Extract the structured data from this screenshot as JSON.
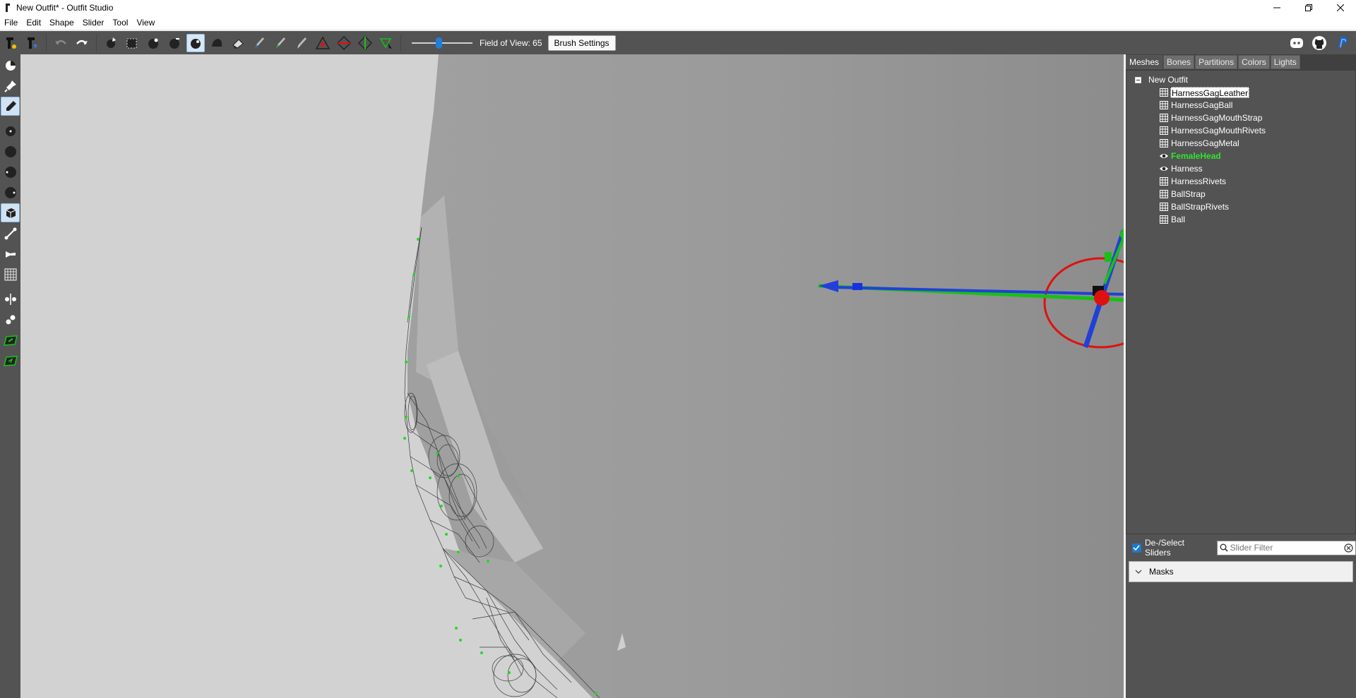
{
  "window": {
    "title": "New Outfit* - Outfit Studio"
  },
  "menu": [
    "File",
    "Edit",
    "Shape",
    "Slider",
    "Tool",
    "View"
  ],
  "toolbar": {
    "fov_label": "Field of View: 65",
    "fov_value": 65,
    "brush_settings_label": "Brush Settings",
    "tools": [
      "new-project-icon",
      "load-project-icon",
      "undo-icon",
      "redo-icon",
      "select-brush-icon",
      "mask-brush-icon",
      "inflate-brush-icon",
      "deflate-brush-icon",
      "move-brush-icon",
      "smooth-brush-icon",
      "undiff-brush-icon",
      "weight-brush-icon",
      "color-brush-icon",
      "alpha-brush-icon",
      "collapse-vertex-icon",
      "flip-edge-icon",
      "split-edge-icon",
      "delete-vertices-icon"
    ],
    "active_tool": "move-brush-icon"
  },
  "toolbar_right": [
    "discord-icon",
    "github-icon",
    "paypal-icon"
  ],
  "leftbar": {
    "tools": [
      "select-tool-icon",
      "pin-tool-icon",
      "brush-tool-icon",
      "brush-size-small-icon",
      "brush-size-medium-icon",
      "brush-size-large-icon",
      "brush-size-xlarge-icon",
      "transform-tool-icon",
      "pivot-tool-icon",
      "bone-tool-icon",
      "grid-icon",
      "symmetry-icon",
      "vertex-select-icon",
      "show-mask-icon",
      "show-weight-icon"
    ],
    "active": [
      "brush-tool-icon",
      "transform-tool-icon"
    ]
  },
  "tabs": [
    "Meshes",
    "Bones",
    "Partitions",
    "Colors",
    "Lights"
  ],
  "active_tab": "Meshes",
  "tree": {
    "root": "New Outfit",
    "items": [
      {
        "label": "HarnessGagLeather",
        "icon": "mesh-grid-icon",
        "state": "selected"
      },
      {
        "label": "HarnessGagBall",
        "icon": "mesh-grid-icon",
        "state": ""
      },
      {
        "label": "HarnessGagMouthStrap",
        "icon": "mesh-grid-icon",
        "state": ""
      },
      {
        "label": "HarnessGagMouthRivets",
        "icon": "mesh-grid-icon",
        "state": ""
      },
      {
        "label": "HarnessGagMetal",
        "icon": "mesh-grid-icon",
        "state": ""
      },
      {
        "label": "FemaleHead",
        "icon": "eye-icon",
        "state": "active"
      },
      {
        "label": "Harness",
        "icon": "eye-icon",
        "state": ""
      },
      {
        "label": "HarnessRivets",
        "icon": "mesh-grid-icon",
        "state": ""
      },
      {
        "label": "BallStrap",
        "icon": "mesh-grid-icon",
        "state": ""
      },
      {
        "label": "BallStrapRivets",
        "icon": "mesh-grid-icon",
        "state": ""
      },
      {
        "label": "Ball",
        "icon": "mesh-grid-icon",
        "state": ""
      }
    ]
  },
  "sliders": {
    "deselect_label": "De-/Select Sliders",
    "deselect_checked": true,
    "filter_placeholder": "Slider Filter",
    "masks_label": "Masks"
  },
  "colors": {
    "toolbar_bg": "#535353",
    "viewport_bg": "#d2d2d2",
    "active_mesh": "#2ee62e",
    "gizmo_x": "#e01010",
    "gizmo_y": "#18c018",
    "gizmo_z": "#1830e0"
  }
}
